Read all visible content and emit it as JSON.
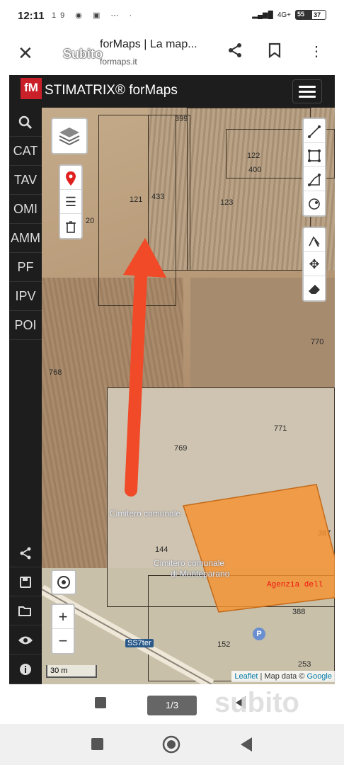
{
  "status": {
    "time": "12:11",
    "notif_icons": "19 ◉ ▣ ⋯ ·",
    "network": "4G+",
    "battery": "55",
    "battery_extra": "37"
  },
  "browser": {
    "overlay_logo": "Subito",
    "title": "forMaps | La map...",
    "url": "formaps.it"
  },
  "app": {
    "logo": "fM",
    "brand": "STIMATRIX® forMaps"
  },
  "sidebar": {
    "items": [
      "CAT",
      "TAV",
      "OMI",
      "AMM",
      "PF",
      "IPV",
      "POI"
    ]
  },
  "map": {
    "parcels": [
      "399",
      "122",
      "400",
      "121",
      "433",
      "123",
      "20",
      "770",
      "768",
      "771",
      "769",
      "144",
      "387",
      "388",
      "152",
      "253"
    ],
    "labels": {
      "cemetery1": "Cimitero comunale",
      "cemetery2": "Cimitero comunale",
      "cemetery3": "di Monteparano",
      "agency": "Agenzia dell",
      "road": "SS7ter"
    },
    "scale": "30 m",
    "attribution_leaflet": "Leaflet",
    "attribution_sep": " | Map data © ",
    "attribution_google": "Google",
    "zoom_in": "+",
    "zoom_out": "−"
  },
  "viewer": {
    "page_indicator": "1/3",
    "watermark": "subito"
  },
  "colors": {
    "sidebar_bg": "#1d1d1d",
    "highlight": "#f5922f",
    "arrow": "#f04a28",
    "logo_red": "#c9202a"
  }
}
